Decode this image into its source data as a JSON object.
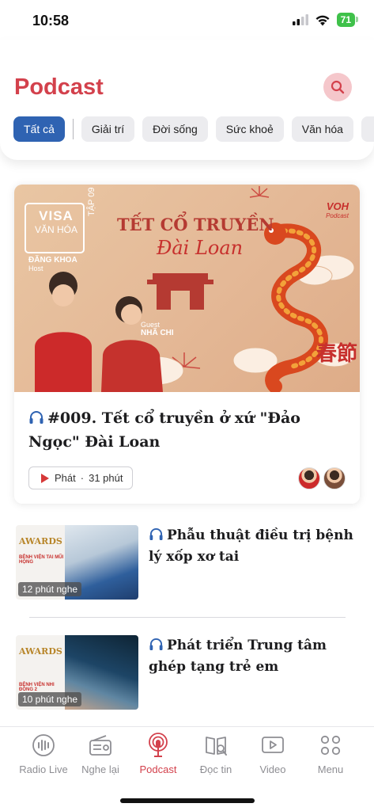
{
  "status_bar": {
    "time": "10:58",
    "battery": "71"
  },
  "header": {
    "title": "Podcast",
    "search_icon": "search-icon"
  },
  "categories": [
    {
      "label": "Tất cả",
      "active": true
    },
    {
      "label": "Giải trí"
    },
    {
      "label": "Đời sống"
    },
    {
      "label": "Sức khoẻ"
    },
    {
      "label": "Văn hóa"
    }
  ],
  "featured": {
    "image_text": {
      "series": "VISA",
      "series_sub": "VĂN HÓA",
      "episode_tag": "TẬP 09",
      "headline": "TẾT CỔ TRUYỀN",
      "headline_script": "Đài Loan",
      "brand": "VOH",
      "brand_sub": "Podcast",
      "host_name": "ĐĂNG KHOA",
      "host_role": "Host",
      "guest_role": "Guest",
      "guest_name": "NHÃ CHI",
      "chinese": "春節"
    },
    "title": "#009. Tết cổ truyền ở xứ \"Đảo Ngọc\" Đài Loan",
    "play_label": "Phát",
    "duration": "31 phút"
  },
  "episodes": [
    {
      "title": "Phẫu thuật điều trị bệnh lý xốp xơ tai",
      "duration": "12 phút nghe",
      "thumb_award": "AWARDS",
      "thumb_caption": "BỆNH VIỆN TAI MŨI HỌNG"
    },
    {
      "title": "Phát triển Trung tâm ghép tạng trẻ em",
      "duration": "10 phút nghe",
      "thumb_award": "AWARDS",
      "thumb_caption": "BỆNH VIỆN NHI ĐỒNG 2"
    }
  ],
  "bottom_nav": [
    {
      "label": "Radio Live",
      "icon": "radio-live-icon"
    },
    {
      "label": "Nghe lại",
      "icon": "radio-icon"
    },
    {
      "label": "Podcast",
      "icon": "podcast-icon",
      "active": true
    },
    {
      "label": "Đọc tin",
      "icon": "book-icon"
    },
    {
      "label": "Video",
      "icon": "video-icon"
    },
    {
      "label": "Menu",
      "icon": "menu-icon"
    }
  ],
  "colors": {
    "accent": "#d3414c",
    "chip_active": "#2f63b2",
    "chip_bg": "#ececef",
    "headphone": "#2f63b2",
    "play": "#d63838"
  }
}
